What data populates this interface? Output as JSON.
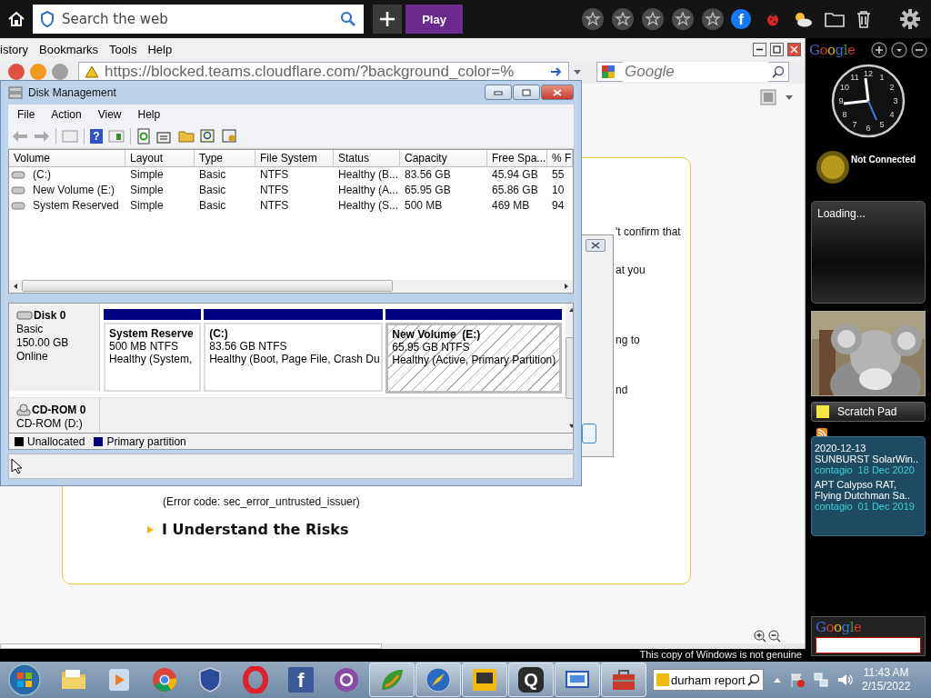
{
  "toolbar": {
    "search_placeholder": "Search the web",
    "play": "Play",
    "facebook_glyph": "f"
  },
  "browser": {
    "menu": [
      "istory",
      "Bookmarks",
      "Tools",
      "Help"
    ],
    "url": "https://blocked.teams.cloudflare.com/?background_color=%",
    "search_placeholder": "Google",
    "page": {
      "fragments": [
        "'t confirm that",
        "at you",
        "ng to",
        "nd"
      ],
      "error_code": "(Error code: sec_error_untrusted_issuer)",
      "risks_link": "I Understand the Risks"
    },
    "notice": "This copy of Windows is not genuine"
  },
  "disk_management": {
    "title": "Disk Management",
    "menu": [
      "File",
      "Action",
      "View",
      "Help"
    ],
    "help_glyph": "?",
    "columns": [
      "Volume",
      "Layout",
      "Type",
      "File System",
      "Status",
      "Capacity",
      "Free Spa...",
      "% F"
    ],
    "rows": [
      [
        "(C:)",
        "Simple",
        "Basic",
        "NTFS",
        "Healthy (B...",
        "83.56 GB",
        "45.94 GB",
        "55"
      ],
      [
        "New Volume (E:)",
        "Simple",
        "Basic",
        "NTFS",
        "Healthy (A...",
        "65.95 GB",
        "65.86 GB",
        "10"
      ],
      [
        "System Reserved",
        "Simple",
        "Basic",
        "NTFS",
        "Healthy (S...",
        "500 MB",
        "469 MB",
        "94"
      ]
    ],
    "disks": [
      {
        "kind": "disk",
        "name": "Disk 0",
        "lines": [
          "Basic",
          "150.00 GB",
          "Online"
        ],
        "partitions": [
          {
            "name": "System Reserve",
            "size": "500 MB NTFS",
            "status": "Healthy (System,",
            "selected": false
          },
          {
            "name": "(C:)",
            "size": "83.56 GB NTFS",
            "status": "Healthy (Boot, Page File, Crash Du",
            "selected": false
          },
          {
            "name": "New Volume  (E:)",
            "size": "65.95 GB NTFS",
            "status": "Healthy (Active, Primary Partition)",
            "selected": true
          }
        ]
      },
      {
        "kind": "cdrom",
        "name": "CD-ROM 0",
        "lines": [
          "CD-ROM (D:)"
        ]
      }
    ],
    "legend": [
      {
        "label": "Unallocated",
        "color": "#000000"
      },
      {
        "label": "Primary partition",
        "color": "#000080"
      }
    ]
  },
  "sidebar": {
    "logo": "Google",
    "clock_numbers": [
      "12",
      "11",
      "1",
      "10",
      "2",
      "9",
      "3",
      "8",
      "4",
      "7",
      "5",
      "6"
    ],
    "weather": "Not Connected",
    "loading": "Loading...",
    "scratch_pad": "Scratch Pad",
    "feed": [
      {
        "title": "2020-12-13 SUNBURST SolarWin..",
        "source": "contagio",
        "date": "18 Dec 2020"
      },
      {
        "title": "APT Calypso RAT, Flying Dutchman Sa..",
        "source": "contagio",
        "date": "01 Dec 2019"
      }
    ],
    "search_logo": "Google"
  },
  "taskbar": {
    "apps": [
      {
        "kind": "folder",
        "running": false
      },
      {
        "kind": "media",
        "running": false
      },
      {
        "kind": "chrome",
        "running": false
      },
      {
        "kind": "shield",
        "running": false
      },
      {
        "kind": "opera",
        "running": false
      },
      {
        "kind": "facebook",
        "glyph": "f",
        "running": false
      },
      {
        "kind": "circle",
        "running": false
      },
      {
        "kind": "leaf",
        "running": true
      },
      {
        "kind": "compass",
        "running": true
      },
      {
        "kind": "tv",
        "running": true
      },
      {
        "kind": "q",
        "glyph": "Q",
        "running": true
      },
      {
        "kind": "window",
        "running": true
      },
      {
        "kind": "toolbox",
        "running": true
      }
    ],
    "search_value": "durham report",
    "time": "11:43 AM",
    "date": "2/15/2022"
  }
}
